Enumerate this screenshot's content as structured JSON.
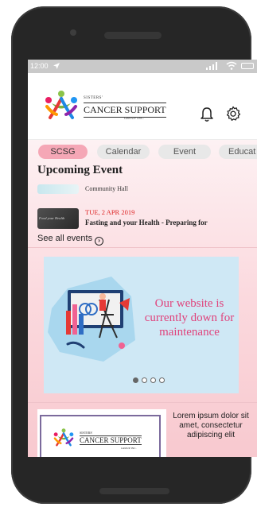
{
  "status_bar": {
    "time": "12:00"
  },
  "header": {
    "logo": {
      "small": "SISTERS'",
      "main": "CANCER SUPPORT",
      "sub": "GROUP INC."
    }
  },
  "tabs": [
    {
      "label": "SCSG",
      "active": true
    },
    {
      "label": "Calendar",
      "active": false
    },
    {
      "label": "Event",
      "active": false
    },
    {
      "label": "Educat",
      "active": false
    }
  ],
  "upcoming": {
    "title": "Upcoming Event",
    "events": [
      {
        "location": "Community Hall"
      },
      {
        "date": "TUE, 2 APR 2019",
        "title": "Fasting and your Health - Preparing for",
        "thumb_text": "Food your Health"
      }
    ],
    "see_all": "See all events"
  },
  "banner": {
    "text": "Our website is currently down for maintenance",
    "dots": 4,
    "active_dot": 0
  },
  "card": {
    "logo": {
      "small": "SISTERS'",
      "main": "CANCER SUPPORT",
      "sub": "GROUP INC."
    },
    "text": "Lorem ipsum dolor sit amet, consectetur adipiscing elit"
  },
  "colors": {
    "tab_active": "#f5a7b6",
    "banner_text": "#e0437c",
    "date": "#dd2222"
  }
}
